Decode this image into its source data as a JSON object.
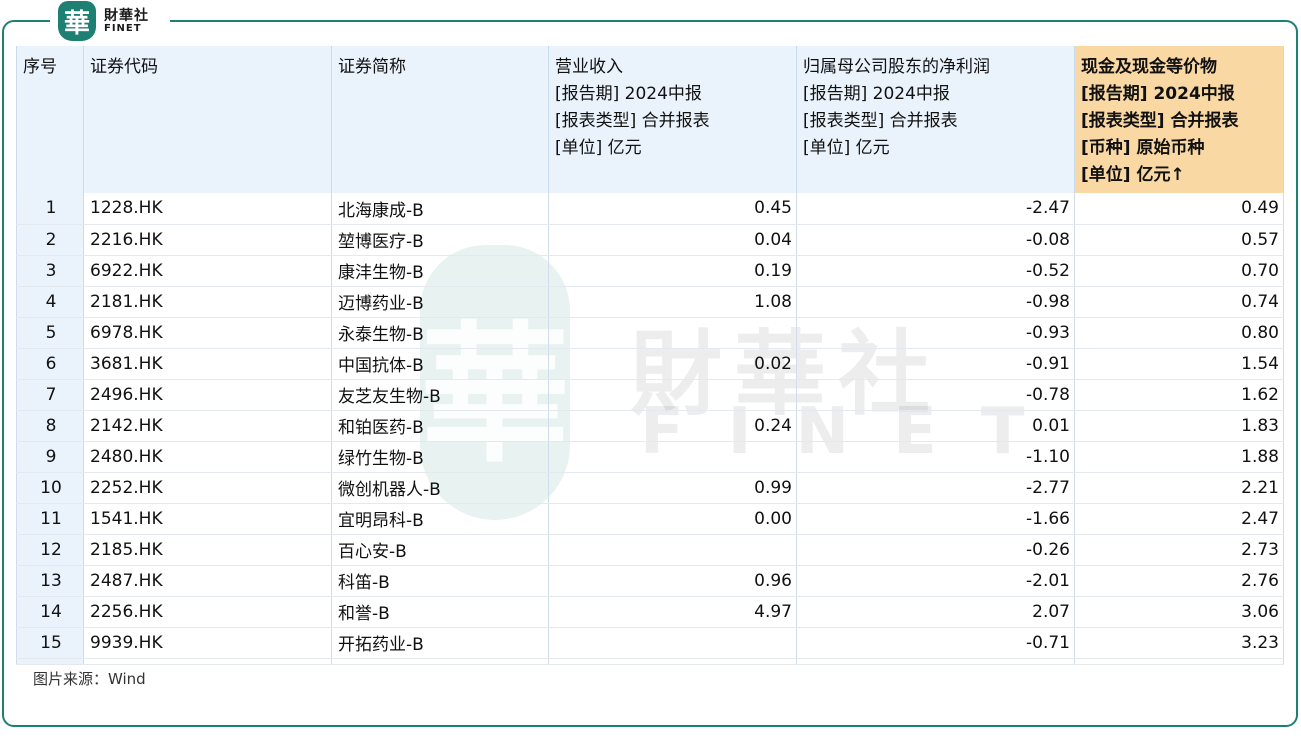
{
  "logo": {
    "seal_char": "華",
    "name_cn": "財華社",
    "name_en": "FINET"
  },
  "watermark": {
    "seal_char": "華",
    "name_cn": "財華社",
    "name_en": "FINET"
  },
  "table": {
    "headers": [
      [
        "序号"
      ],
      [
        "证券代码"
      ],
      [
        "证券简称"
      ],
      [
        "营业收入",
        "[报告期] 2024中报",
        "[报表类型] 合并报表",
        "[单位] 亿元"
      ],
      [
        "归属母公司股东的净利润",
        "[报告期] 2024中报",
        "[报表类型] 合并报表",
        "[单位] 亿元"
      ],
      [
        "现金及现金等价物",
        "[报告期] 2024中报",
        "[报表类型] 合并报表",
        "[币种] 原始币种",
        "[单位] 亿元↑"
      ]
    ],
    "rows": [
      [
        "1",
        "1228.HK",
        "北海康成-B",
        "0.45",
        "-2.47",
        "0.49"
      ],
      [
        "2",
        "2216.HK",
        "堃博医疗-B",
        "0.04",
        "-0.08",
        "0.57"
      ],
      [
        "3",
        "6922.HK",
        "康沣生物-B",
        "0.19",
        "-0.52",
        "0.70"
      ],
      [
        "4",
        "2181.HK",
        "迈博药业-B",
        "1.08",
        "-0.98",
        "0.74"
      ],
      [
        "5",
        "6978.HK",
        "永泰生物-B",
        "",
        "-0.93",
        "0.80"
      ],
      [
        "6",
        "3681.HK",
        "中国抗体-B",
        "0.02",
        "-0.91",
        "1.54"
      ],
      [
        "7",
        "2496.HK",
        "友芝友生物-B",
        "",
        "-0.78",
        "1.62"
      ],
      [
        "8",
        "2142.HK",
        "和铂医药-B",
        "0.24",
        "0.01",
        "1.83"
      ],
      [
        "9",
        "2480.HK",
        "绿竹生物-B",
        "",
        "-1.10",
        "1.88"
      ],
      [
        "10",
        "2252.HK",
        "微创机器人-B",
        "0.99",
        "-2.77",
        "2.21"
      ],
      [
        "11",
        "1541.HK",
        "宜明昂科-B",
        "0.00",
        "-1.66",
        "2.47"
      ],
      [
        "12",
        "2185.HK",
        "百心安-B",
        "",
        "-0.26",
        "2.73"
      ],
      [
        "13",
        "2487.HK",
        "科笛-B",
        "0.96",
        "-2.01",
        "2.76"
      ],
      [
        "14",
        "2256.HK",
        "和誉-B",
        "4.97",
        "2.07",
        "3.06"
      ],
      [
        "15",
        "9939.HK",
        "开拓药业-B",
        "",
        "-0.71",
        "3.23"
      ]
    ]
  },
  "source": "图片来源：Wind",
  "colors": {
    "frame": "#1e7f73",
    "header_bg": "#eaf3fc",
    "highlight_header_bg": "#f9d8a4"
  }
}
